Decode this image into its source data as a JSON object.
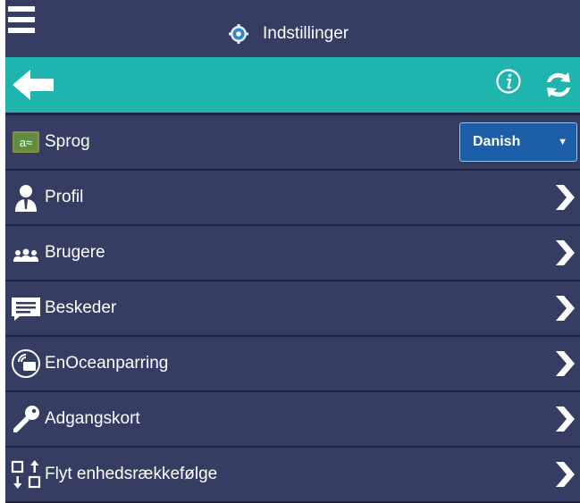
{
  "header": {
    "title": "Indstillinger"
  },
  "language": {
    "label": "Sprog",
    "selected": "Danish",
    "icon_text": "a≈"
  },
  "menu": [
    {
      "id": "profil",
      "label": "Profil",
      "icon": "person-icon"
    },
    {
      "id": "brugere",
      "label": "Brugere",
      "icon": "users-icon"
    },
    {
      "id": "beskeder",
      "label": "Beskeder",
      "icon": "message-icon"
    },
    {
      "id": "enocean",
      "label": "EnOceanparring",
      "icon": "wireless-pairing-icon"
    },
    {
      "id": "adgangskort",
      "label": "Adgangskort",
      "icon": "key-icon"
    },
    {
      "id": "flyt",
      "label": "Flyt enhedsrækkefølge",
      "icon": "reorder-icon"
    }
  ],
  "colors": {
    "background": "#363d63",
    "accent": "#1fb5ae",
    "divider": "#1e2440",
    "select": "#1c5ea8"
  }
}
